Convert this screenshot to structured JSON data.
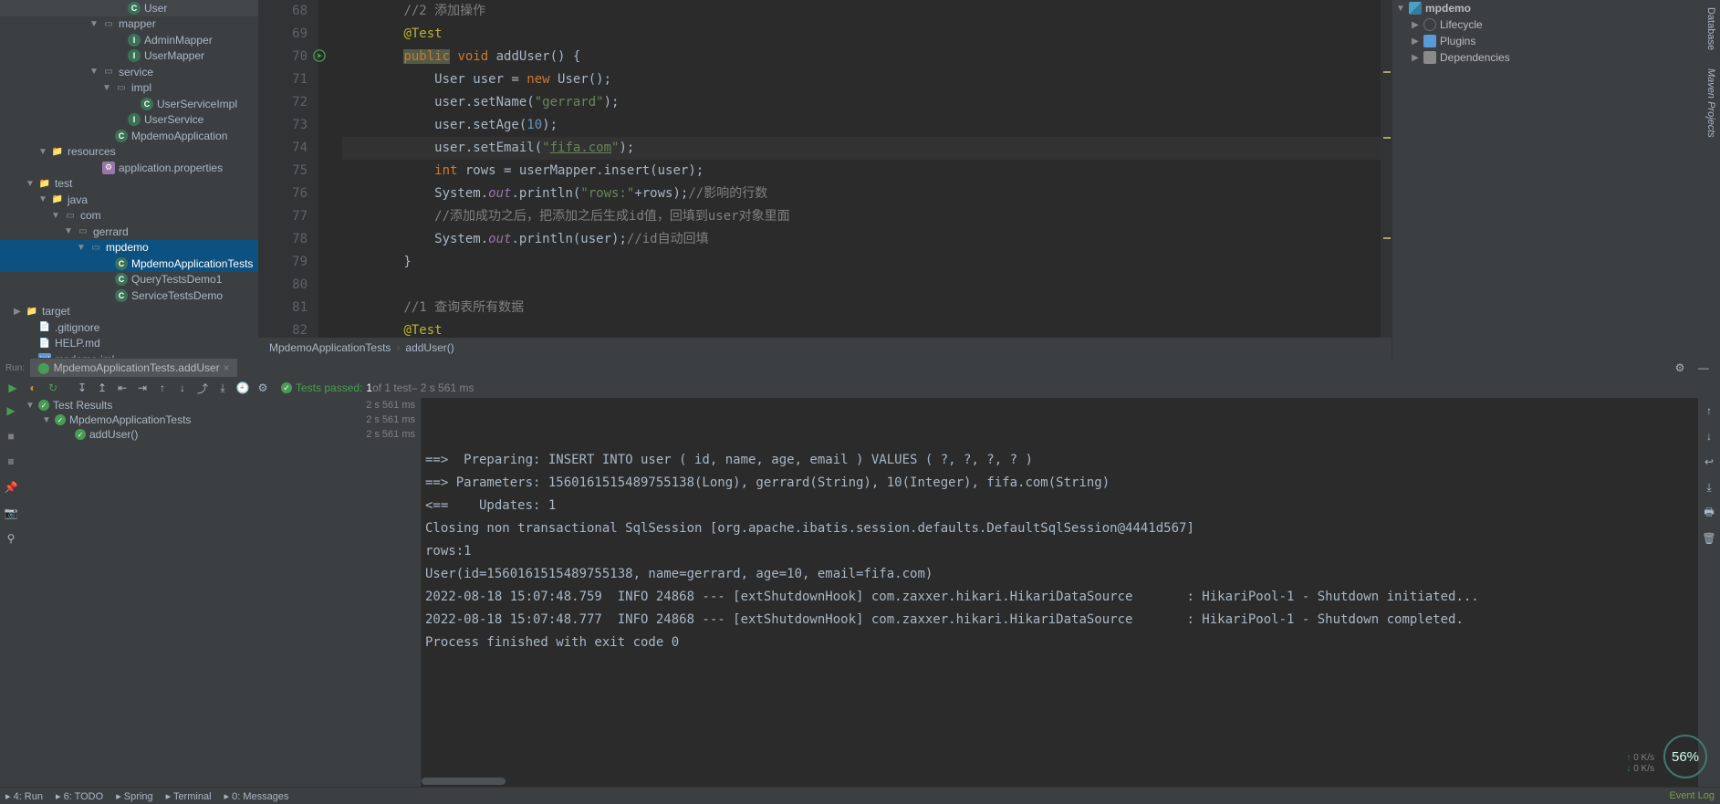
{
  "project_tree": [
    {
      "indent": 126,
      "chev": "",
      "icon": "cls",
      "label": "User"
    },
    {
      "indent": 98,
      "chev": "▼",
      "icon": "pkg",
      "label": "mapper"
    },
    {
      "indent": 126,
      "chev": "",
      "icon": "int",
      "label": "AdminMapper"
    },
    {
      "indent": 126,
      "chev": "",
      "icon": "int",
      "label": "UserMapper"
    },
    {
      "indent": 98,
      "chev": "▼",
      "icon": "pkg",
      "label": "service"
    },
    {
      "indent": 112,
      "chev": "▼",
      "icon": "pkg",
      "label": "impl"
    },
    {
      "indent": 140,
      "chev": "",
      "icon": "cls",
      "label": "UserServiceImpl"
    },
    {
      "indent": 126,
      "chev": "",
      "icon": "int",
      "label": "UserService"
    },
    {
      "indent": 112,
      "chev": "",
      "icon": "cls",
      "label": "MpdemoApplication"
    },
    {
      "indent": 42,
      "chev": "▼",
      "icon": "folder",
      "label": "resources"
    },
    {
      "indent": 98,
      "chev": "",
      "icon": "cfg",
      "label": "application.properties"
    },
    {
      "indent": 28,
      "chev": "▼",
      "icon": "folder",
      "label": "test"
    },
    {
      "indent": 42,
      "chev": "▼",
      "icon": "folder",
      "label": "java"
    },
    {
      "indent": 56,
      "chev": "▼",
      "icon": "pkg",
      "label": "com"
    },
    {
      "indent": 70,
      "chev": "▼",
      "icon": "pkg",
      "label": "gerrard"
    },
    {
      "indent": 84,
      "chev": "▼",
      "icon": "pkg",
      "label": "mpdemo",
      "sel": true
    },
    {
      "indent": 112,
      "chev": "",
      "icon": "cls",
      "label": "MpdemoApplicationTests",
      "sel": true
    },
    {
      "indent": 112,
      "chev": "",
      "icon": "cls",
      "label": "QueryTestsDemo1"
    },
    {
      "indent": 112,
      "chev": "",
      "icon": "cls",
      "label": "ServiceTestsDemo"
    },
    {
      "indent": 14,
      "chev": "▶",
      "icon": "folder-o",
      "label": "target"
    },
    {
      "indent": 28,
      "chev": "",
      "icon": "file",
      "label": ".gitignore"
    },
    {
      "indent": 28,
      "chev": "",
      "icon": "file",
      "label": "HELP.md"
    },
    {
      "indent": 28,
      "chev": "",
      "icon": "iml",
      "label": "mpdemo.iml"
    }
  ],
  "editor": {
    "lines": [
      {
        "n": 68,
        "html": "        <span class='c-comment'>//2 添加操作</span>"
      },
      {
        "n": 69,
        "html": "        <span class='c-anno'>@Test</span>"
      },
      {
        "n": 70,
        "html": "        <span class='c-kwpub'>public</span> <span class='c-kw'>void</span> <span class='c-call'>addUser</span>() {",
        "run": true
      },
      {
        "n": 71,
        "html": "            User user = <span class='c-kw'>new</span> User();"
      },
      {
        "n": 72,
        "html": "            user.setName(<span class='c-str'>\"gerrard\"</span>);"
      },
      {
        "n": 73,
        "html": "            user.setAge(<span class='c-num'>10</span>);"
      },
      {
        "n": 74,
        "html": "            user.setEmail(<span class='c-str'>\"</span><span class='c-link'>fifa.com</span><span class='c-str'>\"</span>);",
        "hl": true
      },
      {
        "n": 75,
        "html": "            <span class='c-kw'>int</span> rows = userMapper.insert(user);"
      },
      {
        "n": 76,
        "html": "            System.<span class='c-static'>out</span>.println(<span class='c-str'>\"rows:\"</span>+rows);<span class='c-comment'>//影响的行数</span>"
      },
      {
        "n": 77,
        "html": "            <span class='c-comment'>//添加成功之后，把添加之后生成id值，回填到user对象里面</span>"
      },
      {
        "n": 78,
        "html": "            System.<span class='c-static'>out</span>.println(user);<span class='c-comment'>//id自动回填</span>"
      },
      {
        "n": 79,
        "html": "        }"
      },
      {
        "n": 80,
        "html": ""
      },
      {
        "n": 81,
        "html": "        <span class='c-comment'>//1 查询表所有数据</span>"
      },
      {
        "n": 82,
        "html": "        <span class='c-anno'>@Test</span>"
      }
    ],
    "breadcrumb": [
      "MpdemoApplicationTests",
      "addUser()"
    ],
    "right_marks": [
      78,
      150,
      260
    ]
  },
  "right_panel": {
    "root": "mpdemo",
    "items": [
      "Lifecycle",
      "Plugins",
      "Dependencies"
    ]
  },
  "side_tabs": [
    "Database",
    "Maven Projects"
  ],
  "run": {
    "label": "Run:",
    "tab": "MpdemoApplicationTests.addUser",
    "status_prefix": "Tests passed:",
    "status_count": "1",
    "status_mid": " of 1 test",
    "status_time": " – 2 s 561 ms",
    "test_tree": [
      {
        "indent": 4,
        "chev": "▼",
        "label": "Test Results",
        "time": "2 s 561 ms"
      },
      {
        "indent": 22,
        "chev": "▼",
        "label": "MpdemoApplicationTests",
        "time": "2 s 561 ms"
      },
      {
        "indent": 44,
        "chev": "",
        "label": "addUser()",
        "time": "2 s 561 ms"
      }
    ],
    "console": [
      "==>  Preparing: INSERT INTO user ( id, name, age, email ) VALUES ( ?, ?, ?, ? ) ",
      "==> Parameters: 1560161515489755138(Long), gerrard(String), 10(Integer), fifa.com(String)",
      "<==    Updates: 1",
      "Closing non transactional SqlSession [org.apache.ibatis.session.defaults.DefaultSqlSession@4441d567]",
      "rows:1",
      "User(id=1560161515489755138, name=gerrard, age=10, email=fifa.com)",
      "2022-08-18 15:07:48.759  INFO 24868 --- [extShutdownHook] com.zaxxer.hikari.HikariDataSource       : HikariPool-1 - Shutdown initiated...",
      "2022-08-18 15:07:48.777  INFO 24868 --- [extShutdownHook] com.zaxxer.hikari.HikariDataSource       : HikariPool-1 - Shutdown completed.",
      "",
      "Process finished with exit code 0",
      ""
    ]
  },
  "bottom": {
    "items": [
      "4: Run",
      "6: TODO",
      "Spring",
      "Terminal",
      "0: Messages"
    ],
    "right": "Event Log",
    "net_up": "0 K/s",
    "net_dn": "0 K/s",
    "pct": "56%"
  }
}
